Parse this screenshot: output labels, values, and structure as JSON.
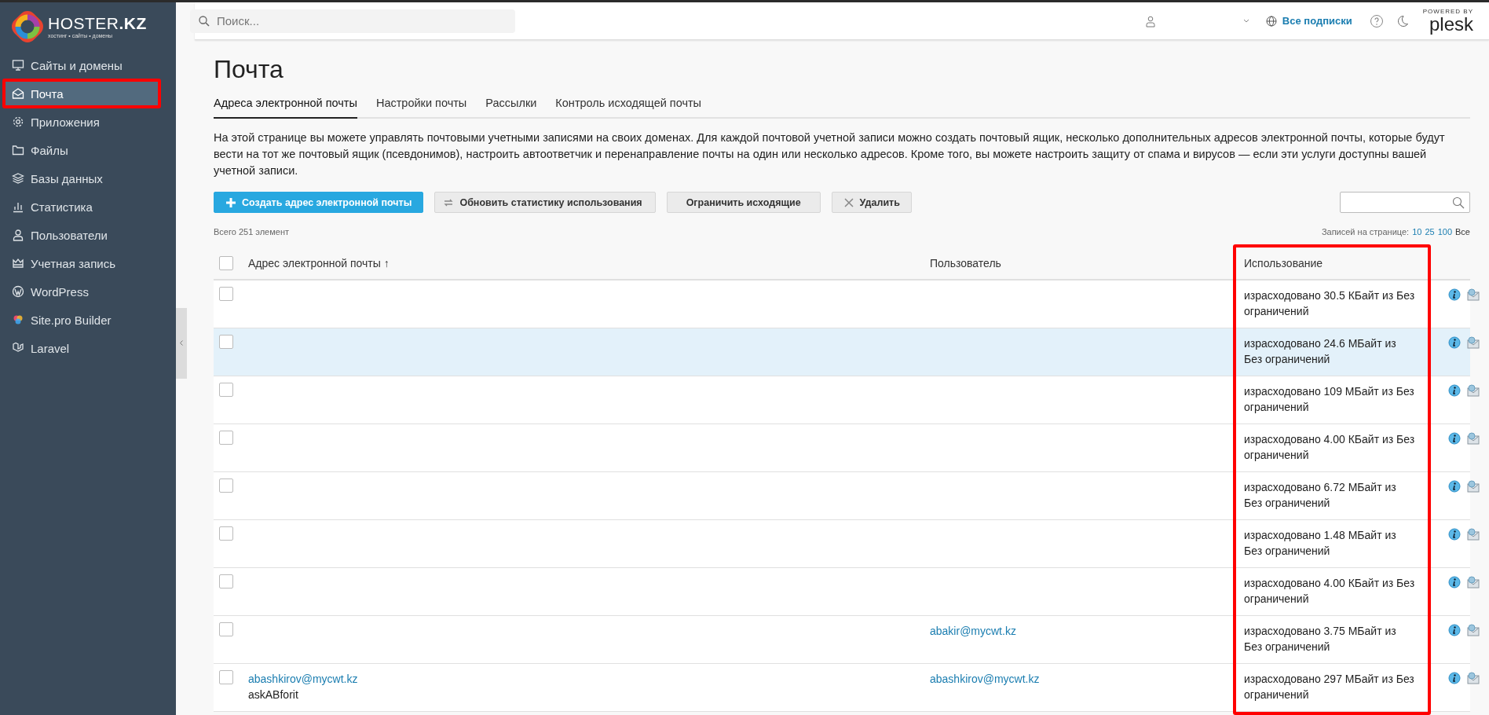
{
  "brand": {
    "name": "HOSTER",
    "suffix": ".KZ",
    "tagline": "хостинг • сайты • домены"
  },
  "sidebar": {
    "items": [
      {
        "label": "Сайты и домены",
        "selected": false,
        "highlighted": false
      },
      {
        "label": "Почта",
        "selected": true,
        "highlighted": true
      },
      {
        "label": "Приложения",
        "selected": false,
        "highlighted": false
      },
      {
        "label": "Файлы",
        "selected": false,
        "highlighted": false
      },
      {
        "label": "Базы данных",
        "selected": false,
        "highlighted": false
      },
      {
        "label": "Статистика",
        "selected": false,
        "highlighted": false
      },
      {
        "label": "Пользователи",
        "selected": false,
        "highlighted": false
      },
      {
        "label": "Учетная запись",
        "selected": false,
        "highlighted": false
      },
      {
        "label": "WordPress",
        "selected": false,
        "highlighted": false
      },
      {
        "label": "Site.pro Builder",
        "selected": false,
        "highlighted": false
      },
      {
        "label": "Laravel",
        "selected": false,
        "highlighted": false
      }
    ]
  },
  "header": {
    "search": {
      "placeholder": "Поиск..."
    },
    "subscriptions": "Все подписки",
    "powered_by": "POWERED BY",
    "plesk": "plesk"
  },
  "page": {
    "title": "Почта",
    "tabs": [
      {
        "label": "Адреса электронной почты",
        "selected": true
      },
      {
        "label": "Настройки почты",
        "selected": false
      },
      {
        "label": "Рассылки",
        "selected": false
      },
      {
        "label": "Контроль исходящей почты",
        "selected": false
      }
    ],
    "description": "На этой странице вы можете управлять почтовыми учетными записями на своих доменах. Для каждой почтовой учетной записи можно создать почтовый ящик, несколько дополнительных адресов электронной почты, которые будут вести на тот же почтовый ящик (псевдонимов), настроить автоответчик и перенаправление почты на один или несколько адресов. Кроме того, вы можете настроить защиту от спама и вирусов — если эти услуги доступны вашей учетной записи.",
    "toolbar": [
      {
        "label": "Создать адрес электронной почты",
        "kind": "primary"
      },
      {
        "label": "Обновить статистику использования",
        "kind": "refresh"
      },
      {
        "label": "Ограничить исходящие",
        "kind": "plain"
      },
      {
        "label": "Удалить",
        "kind": "delete"
      }
    ],
    "total": "Всего 251 элемент",
    "per_page": {
      "label": "Записей на странице:",
      "options": [
        {
          "label": "10",
          "selected": false
        },
        {
          "label": "25",
          "selected": false
        },
        {
          "label": "100",
          "selected": false
        },
        {
          "label": "Все",
          "selected": true
        }
      ]
    }
  },
  "table": {
    "select_all": {
      "checked": false
    },
    "columns": [
      {
        "label": "Адрес электронной почты",
        "sort": "↑",
        "highlighted": false
      },
      {
        "label": "Пользователь",
        "highlighted": false
      },
      {
        "label": "Использование",
        "highlighted": true
      }
    ],
    "rows": [
      {
        "checked": false,
        "hovered": false,
        "usage": "израсходовано 30.5 КБайт из Без ограничений"
      },
      {
        "checked": false,
        "hovered": true,
        "usage": "израсходовано 24.6 МБайт из Без ограничений"
      },
      {
        "checked": false,
        "hovered": false,
        "usage": "израсходовано 109 МБайт из Без ограничений"
      },
      {
        "checked": false,
        "hovered": false,
        "usage": "израсходовано 4.00 КБайт из Без ограничений"
      },
      {
        "checked": false,
        "hovered": false,
        "usage": "израсходовано 6.72 МБайт из Без ограничений"
      },
      {
        "checked": false,
        "hovered": false,
        "usage": "израсходовано 1.48 МБайт из Без ограничений"
      },
      {
        "checked": false,
        "hovered": false,
        "usage": "израсходовано 4.00 КБайт из Без ограничений"
      },
      {
        "checked": false,
        "hovered": false,
        "user": "abakir@mycwt.kz",
        "usage": "израсходовано 3.75 МБайт из Без ограничений"
      },
      {
        "checked": false,
        "hovered": false,
        "address": "abashkirov@mycwt.kz",
        "alias": "askABforit",
        "user": "abashkirov@mycwt.kz",
        "usage": "израсходовано 297 МБайт из Без ограничений"
      }
    ]
  }
}
